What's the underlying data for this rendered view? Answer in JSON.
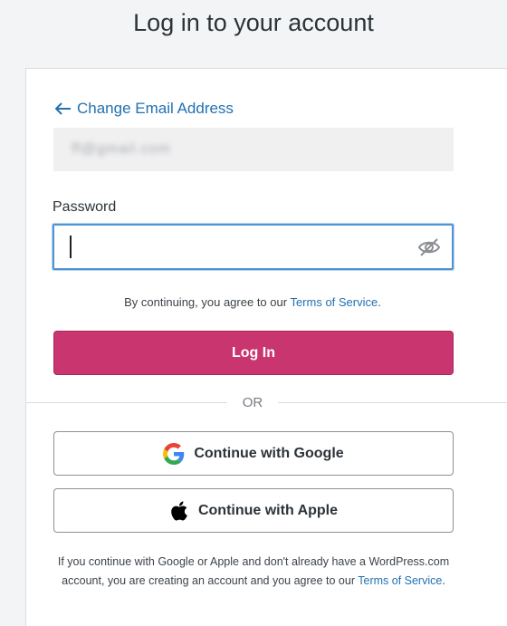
{
  "page": {
    "title": "Log in to your account"
  },
  "form": {
    "change_email_label": "Change Email Address",
    "email_value": "ff@gmail.com",
    "password_label": "Password",
    "password_value": "",
    "agree_prefix": "By continuing, you agree to our ",
    "agree_link": "Terms of Service",
    "agree_suffix": ".",
    "login_label": "Log In",
    "or_label": "OR"
  },
  "social": {
    "google_label": "Continue with Google",
    "apple_label": "Continue with Apple"
  },
  "footer": {
    "text": "If you continue with Google or Apple and don't already have a WordPress.com account, you are creating an account and you agree to our ",
    "link": "Terms of Service",
    "suffix": "."
  },
  "icons": {
    "back": "arrow-left-icon",
    "password_toggle": "eye-slash-icon",
    "google": "google-icon",
    "apple": "apple-icon"
  },
  "colors": {
    "accent": "#c9356e",
    "link": "#2271b1",
    "focus": "#4f94d4"
  }
}
